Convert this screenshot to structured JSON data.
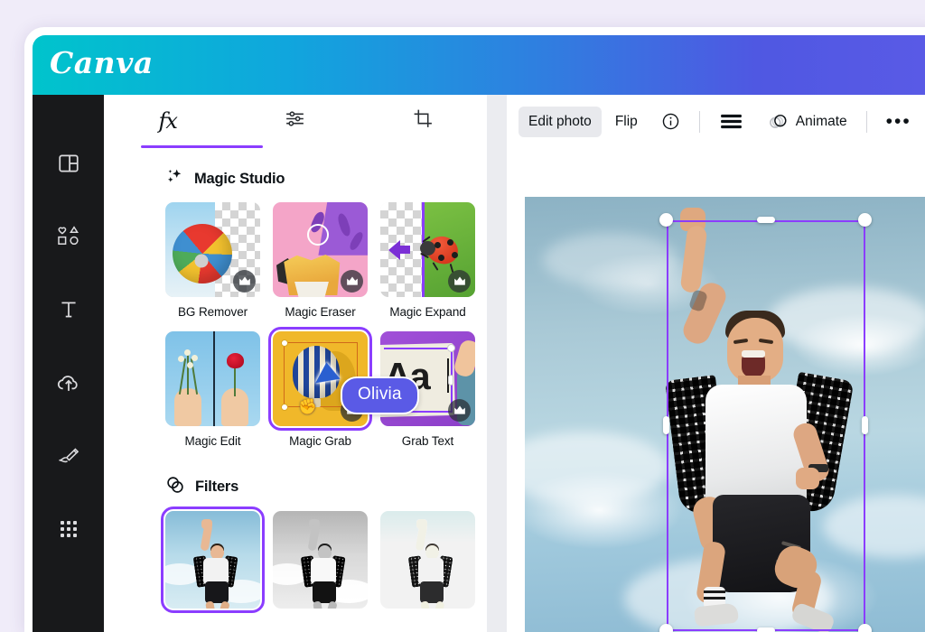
{
  "app": {
    "brand": "Canva",
    "background_color": "#f0ecf9",
    "accent_purple": "#8b3dff",
    "header_gradient_from": "#00c4cc",
    "header_gradient_to": "#5a5ae6"
  },
  "rail": {
    "items": [
      {
        "name": "design-panel",
        "icon": "layout-panel-icon"
      },
      {
        "name": "elements",
        "icon": "shapes-icon"
      },
      {
        "name": "text",
        "icon": "text-t-icon"
      },
      {
        "name": "uploads",
        "icon": "cloud-upload-icon"
      },
      {
        "name": "draw",
        "icon": "pen-draw-icon"
      },
      {
        "name": "apps",
        "icon": "grid-apps-icon"
      }
    ]
  },
  "panel": {
    "tabs": [
      {
        "label": "fx",
        "icon": "fx-icon",
        "active": true
      },
      {
        "label": "",
        "icon": "adjust-sliders-icon",
        "active": false
      },
      {
        "label": "",
        "icon": "crop-icon",
        "active": false
      }
    ],
    "sections": [
      {
        "title": "Magic Studio",
        "icon": "sparkle-icon",
        "tiles": [
          {
            "label": "BG Remover",
            "icon": "beach-ball-thumb",
            "pro": true,
            "selected": false
          },
          {
            "label": "Magic Eraser",
            "icon": "fries-eraser-thumb",
            "pro": true,
            "selected": false
          },
          {
            "label": "Magic Expand",
            "icon": "ladybug-expand-thumb",
            "pro": true,
            "selected": false
          },
          {
            "label": "Magic Edit",
            "icon": "flower-rose-thumb",
            "pro": false,
            "selected": false
          },
          {
            "label": "Magic Grab",
            "icon": "hot-air-balloon-thumb",
            "pro": true,
            "selected": true
          },
          {
            "label": "Grab Text",
            "icon": "aa-text-thumb",
            "pro": true,
            "selected": false
          }
        ]
      },
      {
        "title": "Filters",
        "icon": "filters-circles-icon",
        "thumbs": [
          {
            "name": "filter-original",
            "selected": true,
            "effect": "none"
          },
          {
            "name": "filter-greyscale",
            "selected": false,
            "effect": "grayscale"
          },
          {
            "name": "filter-bright",
            "selected": false,
            "effect": "bright"
          },
          {
            "name": "filter-fourth",
            "selected": false,
            "effect": "none"
          }
        ]
      }
    ]
  },
  "cursor": {
    "label": "Olivia",
    "color": "#5a5ae6"
  },
  "toolbar": {
    "edit_photo_label": "Edit photo",
    "flip_label": "Flip",
    "info_icon": "info-circle-icon",
    "position_icon": "position-lines-icon",
    "animate_label": "Animate",
    "animate_icon": "animate-circles-icon",
    "more_label": "•••"
  },
  "canvas": {
    "selection": {
      "handles": [
        "top-left",
        "top-center",
        "top-right",
        "middle-left",
        "middle-right",
        "bottom-left",
        "bottom-center",
        "bottom-right"
      ],
      "border_color": "#8b3dff"
    },
    "photo_alt": "man jumping in front of blue sky"
  }
}
